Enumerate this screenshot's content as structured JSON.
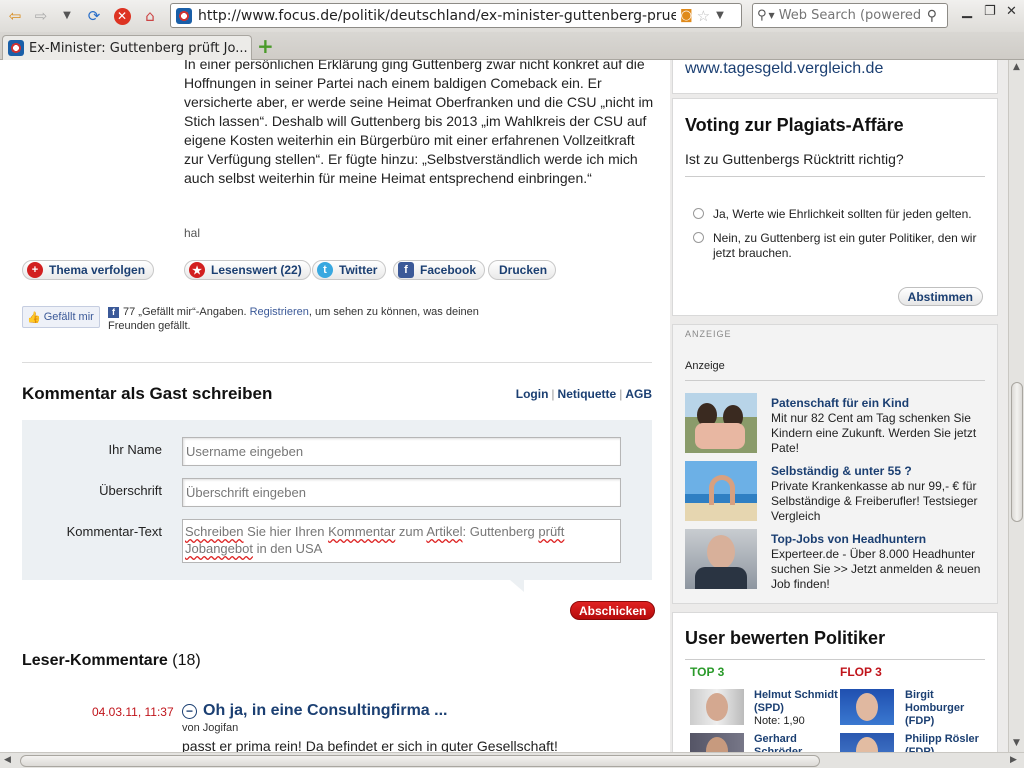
{
  "browser": {
    "url": "http://www.focus.de/politik/deutschland/ex-minister-guttenberg-prueft-jobangebot",
    "search_placeholder": "Web Search (powered",
    "tab_title": "Ex-Minister: Guttenberg prüft Jo..."
  },
  "article": {
    "paragraph": "In einer persönlichen Erklärung ging Guttenberg zwar nicht konkret auf die Hoffnungen in seiner Partei nach einem baldigen Comeback ein. Er versicherte aber, er werde seine Heimat Oberfranken und die CSU „nicht im Stich lassen“. Deshalb will Guttenberg bis 2013 „im Wahlkreis der CSU auf eigene Kosten weiterhin ein Bürgerbüro mit einer erfahrenen Vollzeitkraft zur Verfügung stellen“. Er fügte hinzu: „Selbstverständlich werde ich mich auch selbst weiterhin für meine Heimat entsprechend einbringen.“",
    "author": "hal"
  },
  "share": {
    "follow": "Thema verfolgen",
    "recommend": "Lesenswert (22)",
    "twitter": "Twitter",
    "facebook": "Facebook",
    "print": "Drucken"
  },
  "like": {
    "button": "Gefällt mir",
    "text_pre": "77 „Gefällt mir“-Angaben.",
    "link": "Registrieren",
    "text_post": ", um sehen zu können, was deinen Freunden gefällt."
  },
  "comment_form": {
    "title": "Kommentar als Gast schreiben",
    "login": "Login",
    "netiquette": "Netiquette",
    "agb": "AGB",
    "name_label": "Ihr Name",
    "name_placeholder": "Username eingeben",
    "subject_label": "Überschrift",
    "subject_placeholder": "Überschrift eingeben",
    "text_label": "Kommentar-Text",
    "text_w1": "Schreiben",
    "text_mid1": " Sie hier Ihren ",
    "text_w2": "Kommentar",
    "text_mid2": " zum ",
    "text_w3": "Artikel",
    "text_mid3": ": Guttenberg ",
    "text_w4": "prüft",
    "text_w5": "Jobangebot",
    "text_end": " in den USA",
    "submit": "Abschicken"
  },
  "reader_comments": {
    "title": "Leser-Kommentare",
    "count": "(18)",
    "items": [
      {
        "date": "04.03.11, 11:37",
        "title": "Oh ja, in eine Consultingfirma ...",
        "author": "von Jogifan",
        "body": "passt er prima rein! Da befindet er sich in guter Gesellschaft!"
      }
    ]
  },
  "sidebar": {
    "top_link": "www.tagesgeld.vergleich.de",
    "voting": {
      "title": "Voting zur Plagiats-Affäre",
      "question": "Ist zu Guttenbergs Rücktritt richtig?",
      "options": [
        "Ja, Werte wie Ehrlichkeit sollten für jeden gelten.",
        "Nein, zu Guttenberg ist ein guter Politiker, den wir jetzt brauchen."
      ],
      "button": "Abstimmen"
    },
    "ads": {
      "label_caps": "ANZEIGE",
      "label": "Anzeige",
      "items": [
        {
          "title": "Patenschaft für ein Kind",
          "body": "Mit nur 82 Cent am Tag schenken Sie Kindern eine Zukunft. Werden Sie jetzt Pate!"
        },
        {
          "title": "Selbständig & unter 55 ?",
          "body": "Private Krankenkasse ab nur 99,- € für Selbständige & Freiberufler! Testsieger Vergleich"
        },
        {
          "title": "Top-Jobs von Headhuntern",
          "body": "Experteer.de - Über 8.000 Headhunter suchen Sie >> Jetzt anmelden & neuen Job finden!"
        }
      ]
    },
    "politicians": {
      "title": "User bewerten Politiker",
      "top_label": "TOP 3",
      "flop_label": "FLOP 3",
      "top": [
        {
          "name": "Helmut Schmidt (SPD)",
          "note": "Note: 1,90"
        },
        {
          "name": "Gerhard Schröder",
          "note": ""
        }
      ],
      "flop": [
        {
          "name": "Birgit Homburger (FDP)"
        },
        {
          "name": "Philipp Rösler (FDP)"
        }
      ]
    }
  },
  "colors": {
    "brand_blue": "#1b3f72",
    "accent_red": "#c0141b"
  }
}
